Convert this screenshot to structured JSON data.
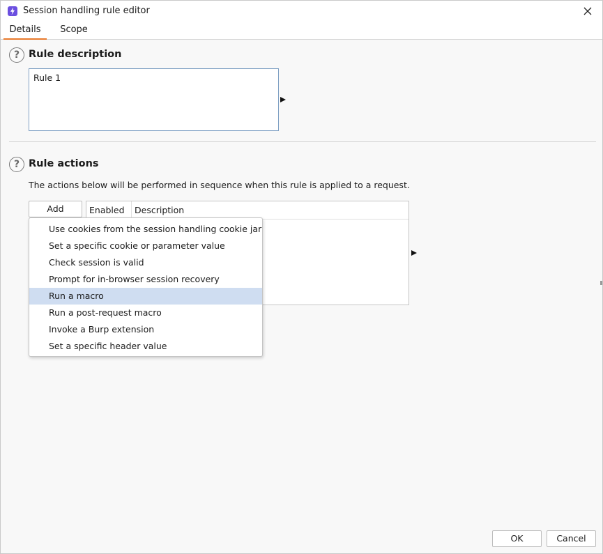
{
  "window": {
    "title": "Session handling rule editor",
    "icon": "lightning-icon",
    "accent_color": "#6b4fe0",
    "tab_underline_color": "#e8792b",
    "selection_color": "#cfddf1"
  },
  "tabs": [
    {
      "label": "Details",
      "active": true
    },
    {
      "label": "Scope",
      "active": false
    }
  ],
  "rule_description": {
    "heading": "Rule description",
    "value": "Rule 1"
  },
  "rule_actions": {
    "heading": "Rule actions",
    "info": "The actions below will be performed in sequence when this rule is applied to a request.",
    "add_label": "Add",
    "columns": [
      "Enabled",
      "Description"
    ],
    "rows": []
  },
  "add_menu": {
    "items": [
      {
        "label": "Use cookies from the session handling cookie jar",
        "selected": false
      },
      {
        "label": "Set a specific cookie or parameter value",
        "selected": false
      },
      {
        "label": "Check session is valid",
        "selected": false
      },
      {
        "label": "Prompt for in-browser session recovery",
        "selected": false
      },
      {
        "label": "Run a macro",
        "selected": true
      },
      {
        "label": "Run a post-request macro",
        "selected": false
      },
      {
        "label": "Invoke a Burp extension",
        "selected": false
      },
      {
        "label": "Set a specific header value",
        "selected": false
      }
    ]
  },
  "footer": {
    "ok_label": "OK",
    "cancel_label": "Cancel"
  }
}
